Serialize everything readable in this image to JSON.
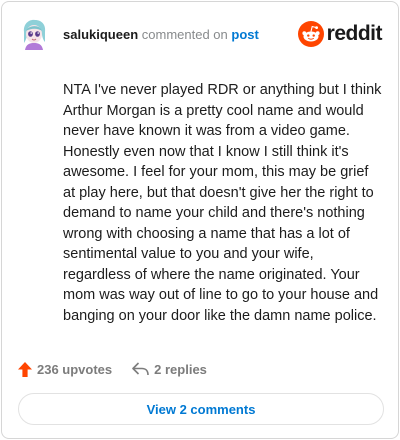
{
  "comment": {
    "username": "salukiqueen",
    "action_text": "commented on",
    "post_link": "post",
    "body": "NTA I've never played RDR or anything but I think Arthur Morgan is a pretty cool name and would never have known it was from a video game. Honestly even now that I know I still think it's awesome. I feel for your mom, this may be grief at play here, but that doesn't give her the right to demand to name your child and there's nothing wrong with choosing a name that has a lot of sentimental value to you and your wife, regardless of where the name originated. Your mom was way out of line to go to your house and banging on your door like the damn name police."
  },
  "brand": {
    "name": "reddit",
    "accent": "#ff4500"
  },
  "actions": {
    "upvotes": "236 upvotes",
    "replies": "2 replies"
  },
  "view_comments_label": "View 2 comments",
  "icons": {
    "avatar": "avatar",
    "logo": "reddit-alien-icon",
    "upvote": "upvote-arrow-icon",
    "reply": "reply-arrow-icon"
  },
  "colors": {
    "link": "#0079d3",
    "muted": "#878a8c",
    "text": "#1c1c1c"
  }
}
